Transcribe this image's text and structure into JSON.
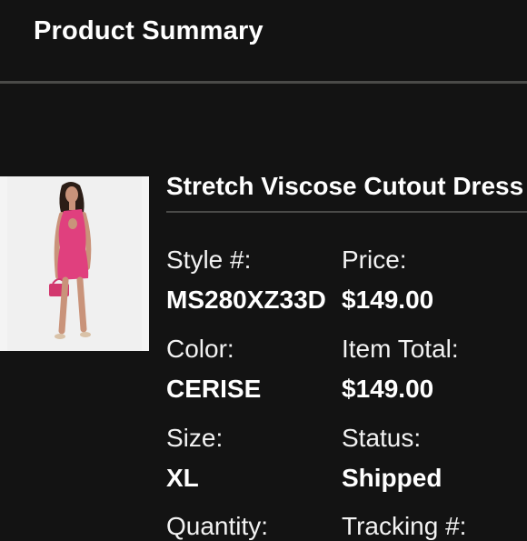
{
  "header": {
    "title": "Product Summary"
  },
  "product": {
    "name": "Stretch Viscose Cutout Dress",
    "image": {
      "subject": "model in pink cutout mini dress holding pink handbag"
    },
    "fields": [
      {
        "label": "Style #:",
        "value": "MS280XZ33D"
      },
      {
        "label": "Price:",
        "value": "$149.00"
      },
      {
        "label": "Color:",
        "value": "CERISE"
      },
      {
        "label": "Item Total:",
        "value": "$149.00"
      },
      {
        "label": "Size:",
        "value": "XL"
      },
      {
        "label": "Status:",
        "value": "Shipped"
      },
      {
        "label": "Quantity:",
        "value": ""
      },
      {
        "label": "Tracking #:",
        "value": ""
      }
    ]
  },
  "colors": {
    "background": "#131313",
    "text": "#ffffff",
    "divider": "#4a4a48",
    "accent_dress": "#e0407e"
  }
}
